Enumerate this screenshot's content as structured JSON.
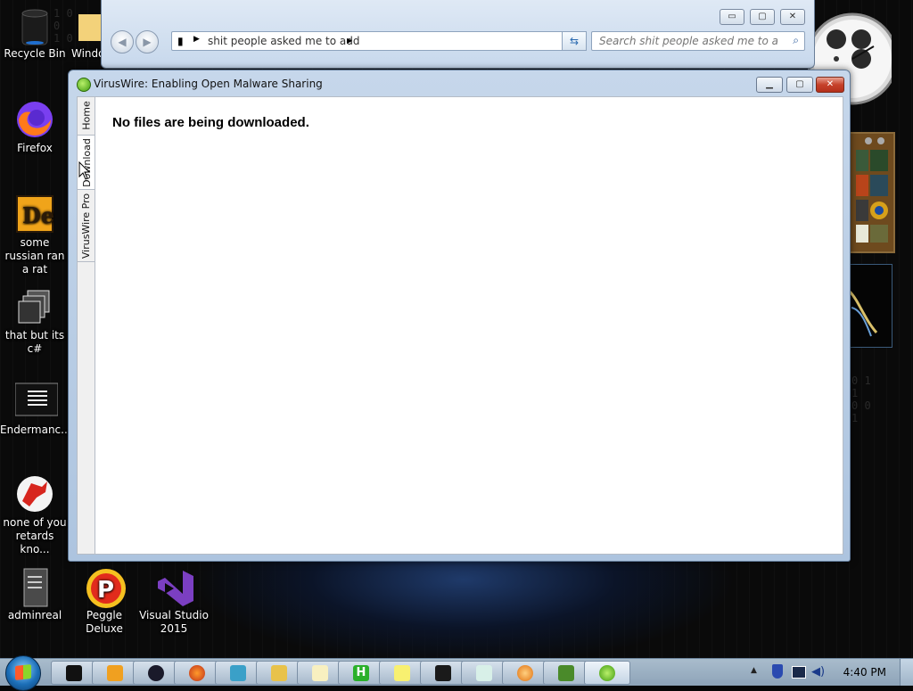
{
  "desktop": {
    "icons": [
      {
        "label": "Recycle Bin",
        "icon": "recycle-bin-icon"
      },
      {
        "label": "Windo",
        "icon": "folder-icon"
      },
      {
        "label": "Firefox",
        "icon": "firefox-icon"
      },
      {
        "label": "some russian ran a rat",
        "icon": "de-app-icon"
      },
      {
        "label": "that but its c#",
        "icon": "stacked-windows-icon"
      },
      {
        "label": "Endermanc...",
        "icon": "console-icon"
      },
      {
        "label": "none of you retards kno...",
        "icon": "dragon-icon"
      },
      {
        "label": "adminreal",
        "icon": "document-icon"
      },
      {
        "label": "Peggle Deluxe",
        "icon": "peggle-icon"
      },
      {
        "label": "Visual Studio 2015",
        "icon": "visual-studio-icon"
      }
    ]
  },
  "explorer": {
    "address_path": "shit people asked me to add",
    "search_placeholder": "Search shit people asked me to add"
  },
  "app": {
    "title": "VirusWire: Enabling Open Malware Sharing",
    "tabs": [
      "Home",
      "Download",
      "VirusWire Pro"
    ],
    "active_tab": "Download",
    "message": "No files are being downloaded."
  },
  "taskbar": {
    "time": "4:40 PM",
    "apps": [
      "cmd-icon",
      "media-player-icon",
      "dark-app-icon",
      "firefox-icon",
      "users-icon",
      "explorer-icon",
      "notepad-icon",
      "h-app-icon",
      "sticky-notes-icon",
      "terminal-icon",
      "notepad2-icon",
      "orange-ball-icon",
      "minecraft-icon",
      "viruswire-icon"
    ]
  },
  "colors": {
    "taskbar": "#9fb3c6",
    "window_frame": "#b9cde6",
    "close_button": "#c6412a"
  }
}
